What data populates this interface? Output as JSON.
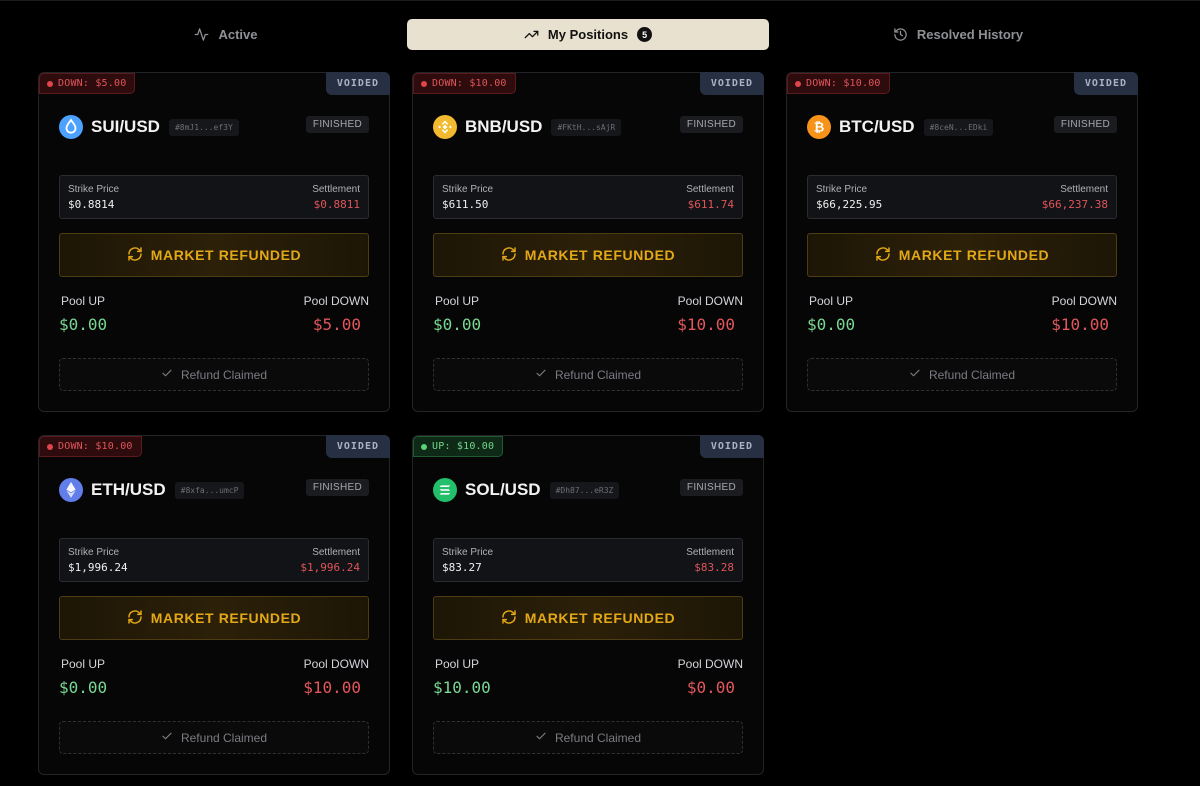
{
  "tabs": [
    {
      "label": "Active",
      "icon": "activity-icon",
      "active": false
    },
    {
      "label": "My Positions",
      "icon": "trending-up-icon",
      "badge": "5",
      "active": true
    },
    {
      "label": "Resolved History",
      "icon": "history-icon",
      "active": false
    }
  ],
  "colors": {
    "accent_tab": "#e8e1cf",
    "refund_gold": "#e3a817",
    "up_green": "#79d792",
    "down_red": "#e3565b",
    "voided_bg": "#273042"
  },
  "cards": [
    {
      "position": "DOWN: $5.00",
      "side": "down",
      "status_badge": "VOIDED",
      "coin_icon": "sui-icon",
      "pair": "SUI/USD",
      "hash": "#8mJ1...ef3Y",
      "state": "FINISHED",
      "strike_label": "Strike Price",
      "strike": "$0.8814",
      "settlement_label": "Settlement",
      "settlement": "$0.8811",
      "banner": "MARKET REFUNDED",
      "pool_up_label": "Pool UP",
      "pool_up": "$0.00",
      "pool_down_label": "Pool DOWN",
      "pool_down": "$5.00",
      "claim": "Refund Claimed"
    },
    {
      "position": "DOWN: $10.00",
      "side": "down",
      "status_badge": "VOIDED",
      "coin_icon": "bnb-icon",
      "pair": "BNB/USD",
      "hash": "#FKtH...sAjR",
      "state": "FINISHED",
      "strike_label": "Strike Price",
      "strike": "$611.50",
      "settlement_label": "Settlement",
      "settlement": "$611.74",
      "banner": "MARKET REFUNDED",
      "pool_up_label": "Pool UP",
      "pool_up": "$0.00",
      "pool_down_label": "Pool DOWN",
      "pool_down": "$10.00",
      "claim": "Refund Claimed"
    },
    {
      "position": "DOWN: $10.00",
      "side": "down",
      "status_badge": "VOIDED",
      "coin_icon": "btc-icon",
      "pair": "BTC/USD",
      "hash": "#8ceN...EDki",
      "state": "FINISHED",
      "strike_label": "Strike Price",
      "strike": "$66,225.95",
      "settlement_label": "Settlement",
      "settlement": "$66,237.38",
      "banner": "MARKET REFUNDED",
      "pool_up_label": "Pool UP",
      "pool_up": "$0.00",
      "pool_down_label": "Pool DOWN",
      "pool_down": "$10.00",
      "claim": "Refund Claimed"
    },
    {
      "position": "DOWN: $10.00",
      "side": "down",
      "status_badge": "VOIDED",
      "coin_icon": "eth-icon",
      "pair": "ETH/USD",
      "hash": "#8xfa...umcP",
      "state": "FINISHED",
      "strike_label": "Strike Price",
      "strike": "$1,996.24",
      "settlement_label": "Settlement",
      "settlement": "$1,996.24",
      "banner": "MARKET REFUNDED",
      "pool_up_label": "Pool UP",
      "pool_up": "$0.00",
      "pool_down_label": "Pool DOWN",
      "pool_down": "$10.00",
      "claim": "Refund Claimed"
    },
    {
      "position": "UP: $10.00",
      "side": "up",
      "status_badge": "VOIDED",
      "coin_icon": "sol-icon",
      "pair": "SOL/USD",
      "hash": "#Dh87...eR3Z",
      "state": "FINISHED",
      "strike_label": "Strike Price",
      "strike": "$83.27",
      "settlement_label": "Settlement",
      "settlement": "$83.28",
      "banner": "MARKET REFUNDED",
      "pool_up_label": "Pool UP",
      "pool_up": "$10.00",
      "pool_down_label": "Pool DOWN",
      "pool_down": "$0.00",
      "claim": "Refund Claimed"
    }
  ]
}
